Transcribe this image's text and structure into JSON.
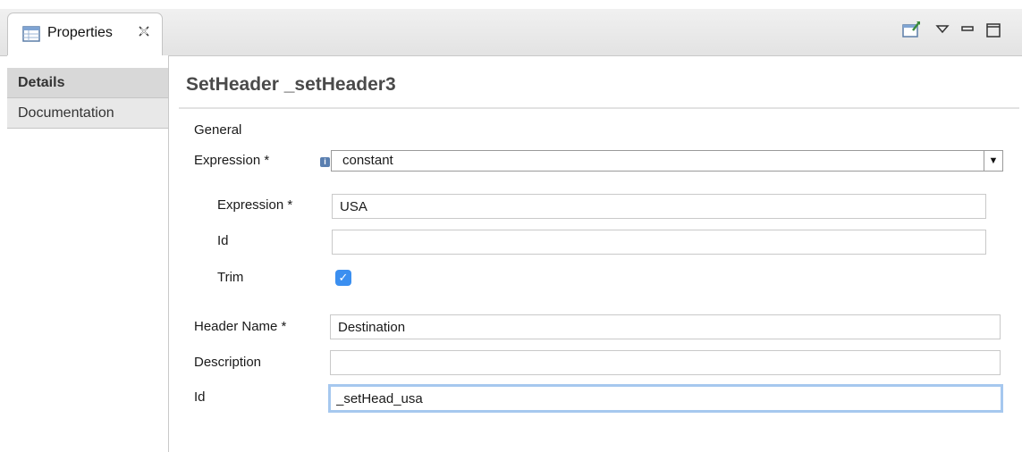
{
  "tab": {
    "label": "Properties",
    "icon": "properties-table-icon",
    "close_icon": "close-icon"
  },
  "toolbar": {
    "icons": [
      "new-window-icon",
      "view-menu-icon",
      "minimize-icon",
      "maximize-icon"
    ]
  },
  "nav": {
    "items": [
      {
        "label": "Details",
        "selected": true
      },
      {
        "label": "Documentation",
        "selected": false
      }
    ]
  },
  "header": {
    "title": "SetHeader _setHeader3"
  },
  "form": {
    "section_label": "General",
    "expression_label": "Expression *",
    "expression_select_value": "constant",
    "sub": {
      "expression_label": "Expression *",
      "expression_value": "USA",
      "id_label": "Id",
      "id_value": "",
      "trim_label": "Trim",
      "trim_checked": true
    },
    "header_name_label": "Header Name *",
    "header_name_value": "Destination",
    "description_label": "Description",
    "description_value": "",
    "id_label": "Id",
    "id_value": "_setHead_usa"
  },
  "colors": {
    "accent": "#3b8ff0",
    "focus_ring": "#a6c8ef",
    "selected_nav": "#d8d8d8"
  }
}
